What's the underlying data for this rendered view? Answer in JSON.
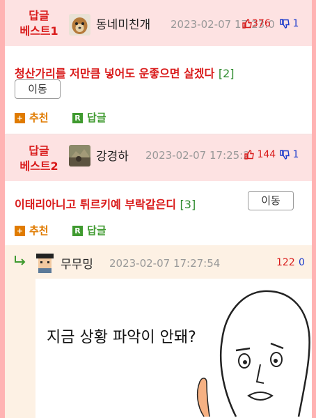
{
  "comments": [
    {
      "best_line1": "답글",
      "best_line2": "베스트1",
      "nick": "동네미친개",
      "date": "2023-02-07 17:23:0",
      "up": "376",
      "down": "1",
      "text": "청산가리를 저만큼 넣어도 운좋으면 살겠다",
      "reply_count": "[2]",
      "move_label": "이동",
      "recommend_label": "추천",
      "reply_label": "답글"
    },
    {
      "best_line1": "답글",
      "best_line2": "베스트2",
      "nick": "강경하",
      "date": "2023-02-07 17:25:2",
      "up": "144",
      "down": "1",
      "text": "이태리아니고 튀르키예 부락같은디",
      "reply_count": "[3]",
      "move_label": "이동",
      "recommend_label": "추천",
      "reply_label": "답글"
    }
  ],
  "reply": {
    "nick": "무무밍",
    "date": "2023-02-07 17:27:54",
    "up": "122",
    "down": "0",
    "image_text": "지금 상황 파악이 안돼?"
  },
  "colors": {
    "best_red": "#d91a1a",
    "recommend_orange": "#e07b00",
    "reply_green": "#3f9a2f",
    "down_blue": "#1a3acc"
  },
  "icons": {
    "thumb_up": "thumbs-up-icon",
    "thumb_down": "thumbs-down-icon",
    "recommend": "plus-square-icon",
    "reply": "r-square-icon",
    "reply_arrow": "reply-arrow-icon"
  }
}
